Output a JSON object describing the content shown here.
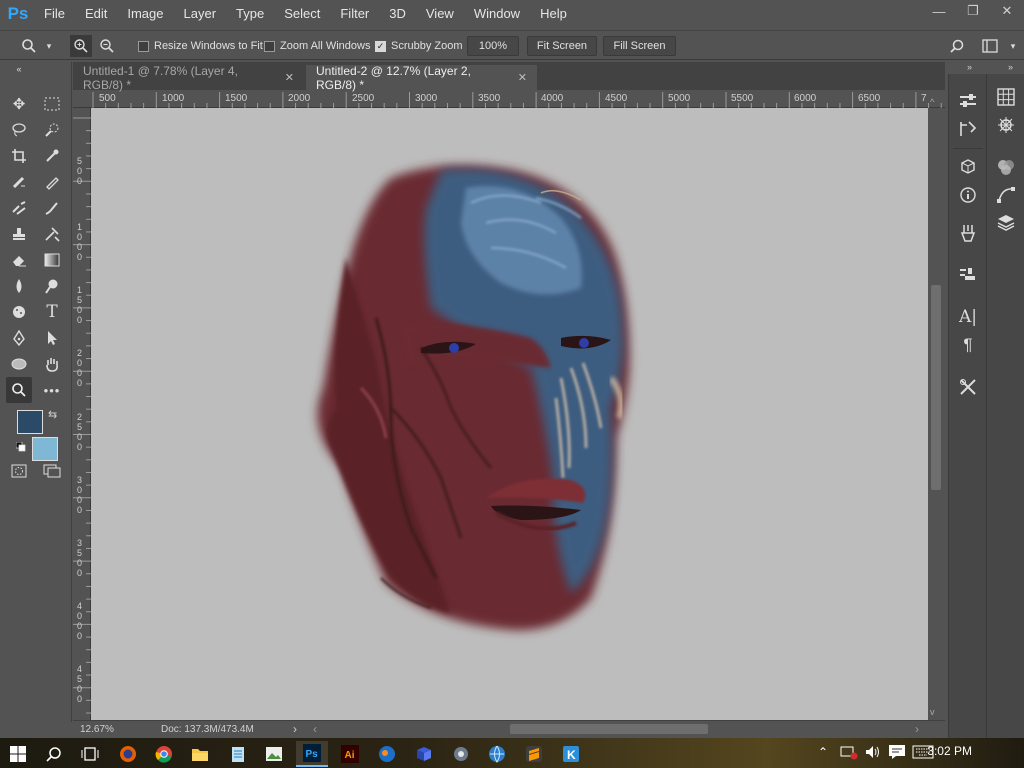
{
  "app": {
    "logo": "Ps",
    "menu": [
      "File",
      "Edit",
      "Image",
      "Layer",
      "Type",
      "Select",
      "Filter",
      "3D",
      "View",
      "Window",
      "Help"
    ],
    "window_controls": [
      "—",
      "❐",
      "✕"
    ]
  },
  "options": {
    "resize_windows": {
      "label": "Resize Windows to Fit",
      "checked": false
    },
    "zoom_all": {
      "label": "Zoom All Windows",
      "checked": false
    },
    "scrubby_zoom": {
      "label": "Scrubby Zoom",
      "checked": true
    },
    "zoom_value": "100%",
    "fit_screen": "Fit Screen",
    "fill_screen": "Fill Screen"
  },
  "tabs": [
    {
      "label": "Untitled-1 @ 7.78% (Layer 4, RGB/8) *",
      "active": false
    },
    {
      "label": "Untitled-2 @ 12.7% (Layer 2, RGB/8) *",
      "active": true
    }
  ],
  "ruler": {
    "h_labels": [
      "500",
      "1000",
      "1500",
      "2000",
      "2500",
      "3000",
      "3500",
      "4000",
      "4500",
      "5000",
      "5500",
      "6000",
      "6500",
      "7"
    ],
    "v_labels": [
      "500",
      "1000",
      "1500",
      "2000",
      "2500",
      "3000",
      "3500",
      "4000",
      "4500"
    ]
  },
  "status": {
    "zoom": "12.67%",
    "doc": "Doc: 137.3M/473.4M"
  },
  "colors": {
    "foreground": "#2b4a68",
    "background": "#7eb8d4"
  },
  "taskbar": {
    "clock": "3:02 PM"
  }
}
